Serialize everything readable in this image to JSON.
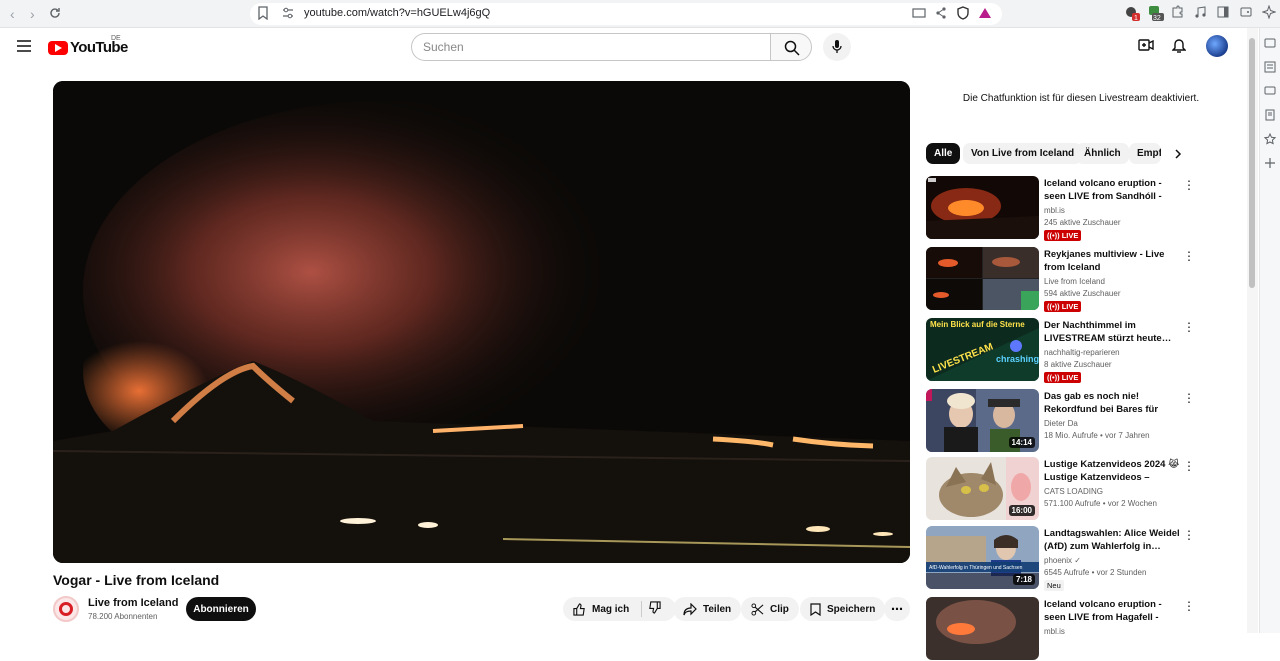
{
  "browser": {
    "url": "youtube.com/watch?v=hGUELw4j6gQ",
    "ext_badge_1": "1",
    "ext_badge_2": "32"
  },
  "header": {
    "logo_text": "YouTube",
    "country_code": "DE",
    "search_placeholder": "Suchen"
  },
  "video": {
    "title": "Vogar - Live from Iceland",
    "channel": "Live from Iceland",
    "subscribers": "78.200 Abonnenten",
    "subscribe_label": "Abonnieren",
    "like_label": "Mag ich",
    "share_label": "Teilen",
    "clip_label": "Clip",
    "save_label": "Speichern"
  },
  "chat_note": "Die Chatfunktion ist für diesen Livestream deaktiviert.",
  "chips": [
    "Alle",
    "Von Live from Iceland",
    "Ähnlich",
    "Empf"
  ],
  "recommendations": [
    {
      "title": "Iceland volcano eruption - seen LIVE from Sandhóll - Close up",
      "channel": "mbl.is",
      "meta": "245 aktive Zuschauer",
      "badge": "LIVE",
      "duration": ""
    },
    {
      "title": "Reykjanes multiview - Live from Iceland",
      "channel": "Live from Iceland",
      "meta": "594 aktive Zuschauer",
      "badge": "LIVE",
      "duration": ""
    },
    {
      "title": "Der Nachthimmel im LIVESTREAM stürzt heute…",
      "channel": "nachhaltig-reparieren",
      "meta": "8 aktive Zuschauer",
      "badge": "LIVE",
      "duration": ""
    },
    {
      "title": "Das gab es noch nie! Rekordfund bei Bares für Rares",
      "channel": "Dieter Da",
      "meta": "18 Mio. Aufrufe  •  vor 7 Jahren",
      "badge": "",
      "duration": "14:14"
    },
    {
      "title": "Lustige Katzenvideos 2024 😹 Lustige Katzenvideos – Lustig…",
      "channel": "CATS LOADING",
      "meta": "571.100 Aufrufe  •  vor 2 Wochen",
      "badge": "",
      "duration": "16:00"
    },
    {
      "title": "Landtagswahlen: Alice Weidel (AfD) zum Wahlerfolg in…",
      "channel": "phoenix ✓",
      "meta": "6545 Aufrufe  •  vor 2 Stunden",
      "badge": "Neu",
      "duration": "7:18"
    },
    {
      "title": "Iceland volcano eruption - seen LIVE from Hagafell - Close up",
      "channel": "mbl.is",
      "meta": "",
      "badge": "",
      "duration": ""
    }
  ],
  "thumb_texts": {
    "t3_top": "Mein Blick auf die Sterne",
    "t3_mid": "LIVESTREAM",
    "t3_side": "chrashing?",
    "t6_caption": "AfD-Wahlerfolg in Thüringen und Sachsen"
  },
  "colors": {
    "brand_red": "#ff0000",
    "live_red": "#cc0000"
  }
}
